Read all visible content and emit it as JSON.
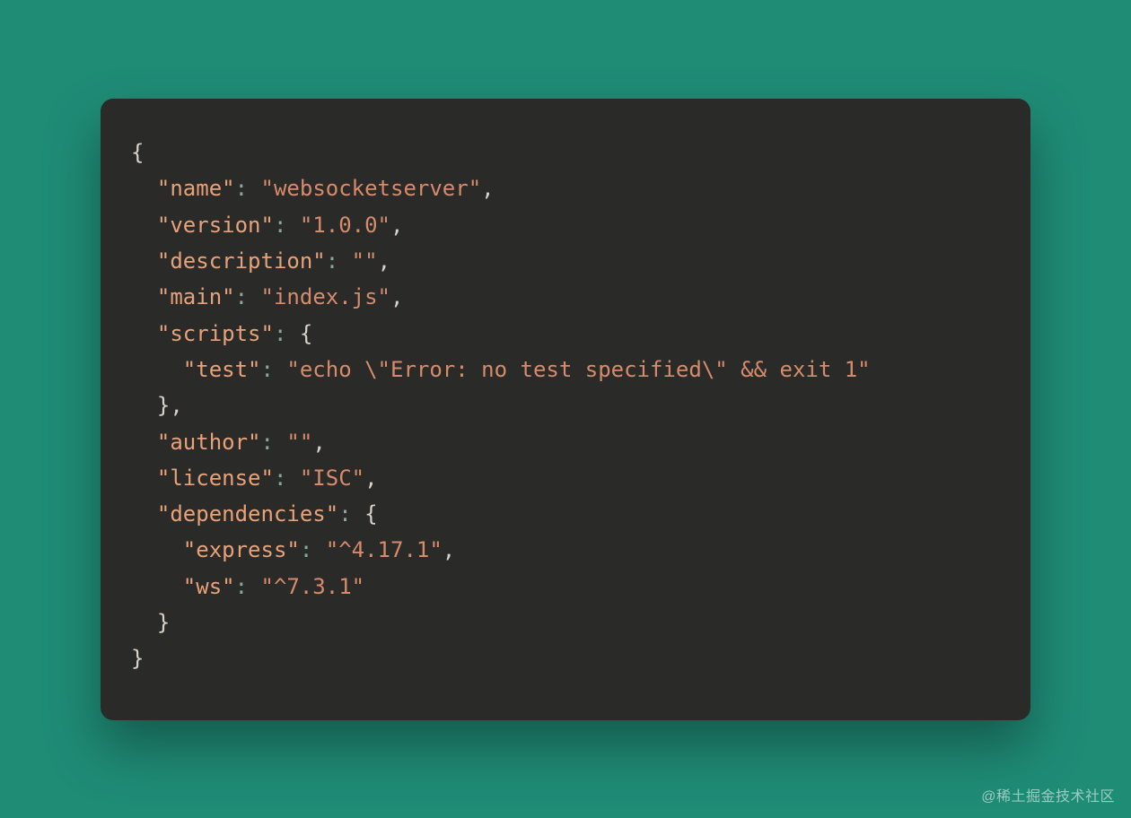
{
  "watermark": "@稀土掘金技术社区",
  "code": {
    "lines": [
      {
        "indent": 0,
        "segments": [
          {
            "cls": "tok-brace",
            "text": "{"
          }
        ]
      },
      {
        "indent": 1,
        "segments": [
          {
            "cls": "tok-key",
            "text": "\"name\""
          },
          {
            "cls": "tok-colon",
            "text": ":"
          },
          {
            "cls": "tok-punct",
            "text": " "
          },
          {
            "cls": "tok-string",
            "text": "\"websocketserver\""
          },
          {
            "cls": "tok-punct",
            "text": ","
          }
        ]
      },
      {
        "indent": 1,
        "segments": [
          {
            "cls": "tok-key",
            "text": "\"version\""
          },
          {
            "cls": "tok-colon",
            "text": ":"
          },
          {
            "cls": "tok-punct",
            "text": " "
          },
          {
            "cls": "tok-string",
            "text": "\"1.0.0\""
          },
          {
            "cls": "tok-punct",
            "text": ","
          }
        ]
      },
      {
        "indent": 1,
        "segments": [
          {
            "cls": "tok-key",
            "text": "\"description\""
          },
          {
            "cls": "tok-colon",
            "text": ":"
          },
          {
            "cls": "tok-punct",
            "text": " "
          },
          {
            "cls": "tok-string",
            "text": "\"\""
          },
          {
            "cls": "tok-punct",
            "text": ","
          }
        ]
      },
      {
        "indent": 1,
        "segments": [
          {
            "cls": "tok-key",
            "text": "\"main\""
          },
          {
            "cls": "tok-colon",
            "text": ":"
          },
          {
            "cls": "tok-punct",
            "text": " "
          },
          {
            "cls": "tok-string",
            "text": "\"index.js\""
          },
          {
            "cls": "tok-punct",
            "text": ","
          }
        ]
      },
      {
        "indent": 1,
        "segments": [
          {
            "cls": "tok-key",
            "text": "\"scripts\""
          },
          {
            "cls": "tok-colon",
            "text": ":"
          },
          {
            "cls": "tok-punct",
            "text": " "
          },
          {
            "cls": "tok-brace",
            "text": "{"
          }
        ]
      },
      {
        "indent": 2,
        "segments": [
          {
            "cls": "tok-key",
            "text": "\"test\""
          },
          {
            "cls": "tok-colon",
            "text": ":"
          },
          {
            "cls": "tok-punct",
            "text": " "
          },
          {
            "cls": "tok-string",
            "text": "\"echo \\\"Error: no test specified\\\" && exit 1\""
          }
        ]
      },
      {
        "indent": 1,
        "segments": [
          {
            "cls": "tok-brace",
            "text": "}"
          },
          {
            "cls": "tok-punct",
            "text": ","
          }
        ]
      },
      {
        "indent": 1,
        "segments": [
          {
            "cls": "tok-key",
            "text": "\"author\""
          },
          {
            "cls": "tok-colon",
            "text": ":"
          },
          {
            "cls": "tok-punct",
            "text": " "
          },
          {
            "cls": "tok-string",
            "text": "\"\""
          },
          {
            "cls": "tok-punct",
            "text": ","
          }
        ]
      },
      {
        "indent": 1,
        "segments": [
          {
            "cls": "tok-key",
            "text": "\"license\""
          },
          {
            "cls": "tok-colon",
            "text": ":"
          },
          {
            "cls": "tok-punct",
            "text": " "
          },
          {
            "cls": "tok-string",
            "text": "\"ISC\""
          },
          {
            "cls": "tok-punct",
            "text": ","
          }
        ]
      },
      {
        "indent": 1,
        "segments": [
          {
            "cls": "tok-key",
            "text": "\"dependencies\""
          },
          {
            "cls": "tok-colon",
            "text": ":"
          },
          {
            "cls": "tok-punct",
            "text": " "
          },
          {
            "cls": "tok-brace",
            "text": "{"
          }
        ]
      },
      {
        "indent": 2,
        "segments": [
          {
            "cls": "tok-key",
            "text": "\"express\""
          },
          {
            "cls": "tok-colon",
            "text": ":"
          },
          {
            "cls": "tok-punct",
            "text": " "
          },
          {
            "cls": "tok-string",
            "text": "\"^4.17.1\""
          },
          {
            "cls": "tok-punct",
            "text": ","
          }
        ]
      },
      {
        "indent": 2,
        "segments": [
          {
            "cls": "tok-key",
            "text": "\"ws\""
          },
          {
            "cls": "tok-colon",
            "text": ":"
          },
          {
            "cls": "tok-punct",
            "text": " "
          },
          {
            "cls": "tok-string",
            "text": "\"^7.3.1\""
          }
        ]
      },
      {
        "indent": 1,
        "segments": [
          {
            "cls": "tok-brace",
            "text": "}"
          }
        ]
      },
      {
        "indent": 0,
        "segments": [
          {
            "cls": "tok-brace",
            "text": "}"
          }
        ]
      }
    ]
  }
}
